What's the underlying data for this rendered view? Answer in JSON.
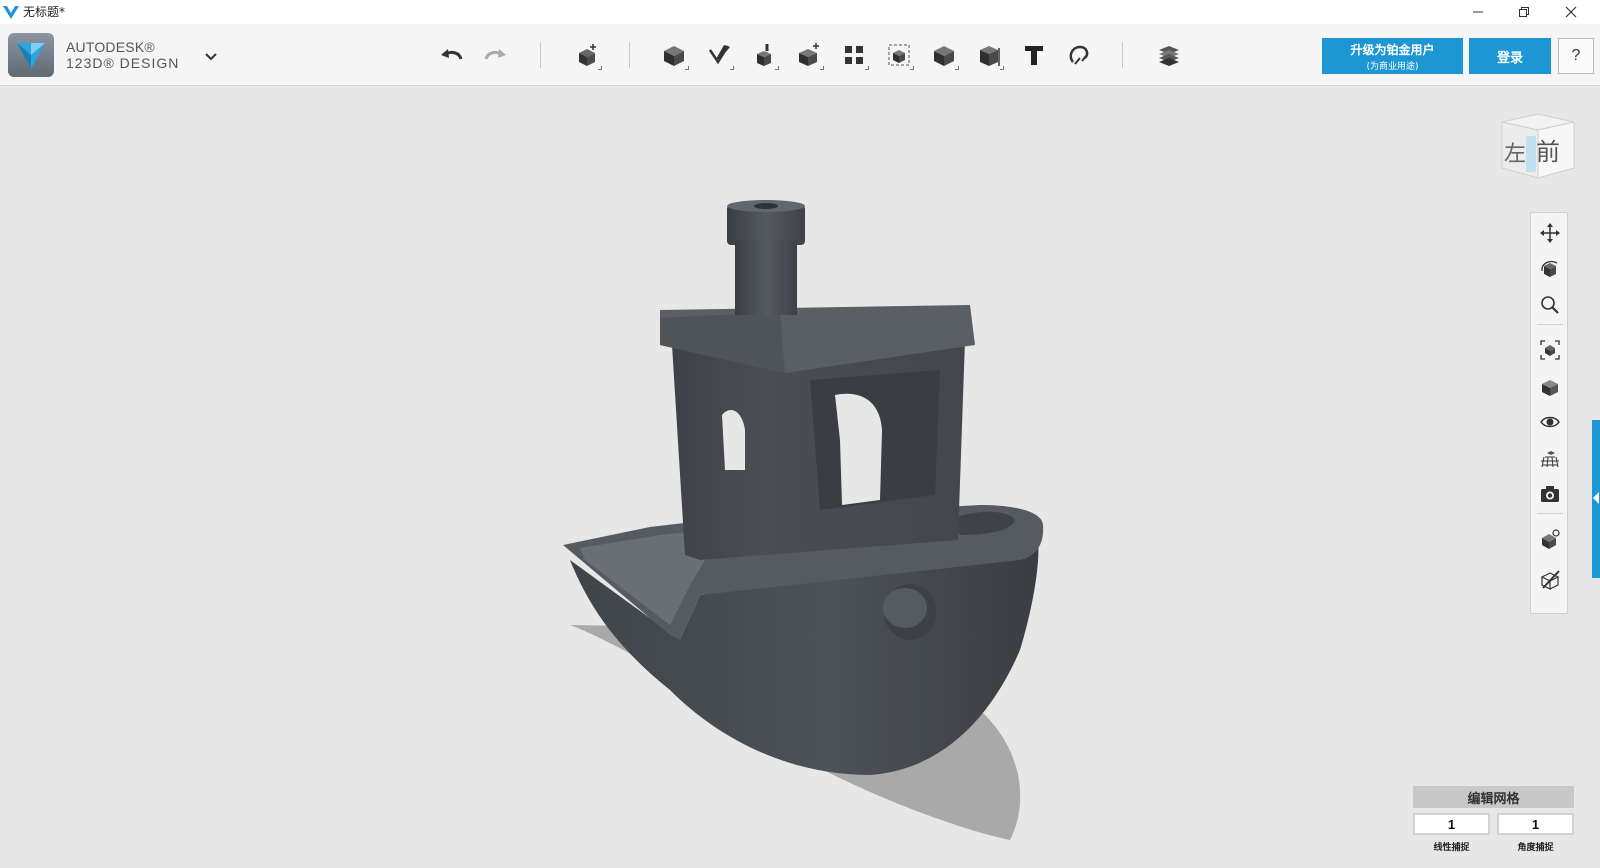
{
  "window": {
    "title": "无标题*",
    "controls": [
      "minimize",
      "restore",
      "close"
    ]
  },
  "brand": {
    "line1": "AUTODESK®",
    "line2": "123D® DESIGN"
  },
  "toolbar": {
    "tools": [
      {
        "name": "undo",
        "icon": "undo-arrow-icon"
      },
      {
        "name": "redo",
        "icon": "redo-arrow-icon"
      },
      {
        "name": "transform",
        "icon": "cube-move-icon"
      },
      {
        "name": "primitives",
        "icon": "primitive-box-icon"
      },
      {
        "name": "sketch",
        "icon": "sketch-pencil-icon"
      },
      {
        "name": "construct",
        "icon": "extrude-icon"
      },
      {
        "name": "modify",
        "icon": "modify-icon"
      },
      {
        "name": "pattern",
        "icon": "pattern-grid-icon"
      },
      {
        "name": "grouping",
        "icon": "group-icon"
      },
      {
        "name": "combine",
        "icon": "combine-icon"
      },
      {
        "name": "measure",
        "icon": "measure-icon"
      },
      {
        "name": "text",
        "icon": "text-icon"
      },
      {
        "name": "snap",
        "icon": "snap-magnet-icon"
      },
      {
        "name": "material",
        "icon": "material-stack-icon"
      }
    ],
    "upgrade_line1": "升级为铂金用户",
    "upgrade_line2": "(为商业用途)",
    "login_label": "登录",
    "help_label": "?"
  },
  "viewcube": {
    "left_face": "左",
    "front_face": "前"
  },
  "nav_panel": {
    "tools": [
      "pan-icon",
      "orbit-icon",
      "zoom-icon",
      "fit-icon",
      "views-icon",
      "visibility-icon",
      "grid-icon",
      "screenshot-icon",
      "material-icon",
      "outline-icon"
    ]
  },
  "snap_panel": {
    "title": "编辑网格",
    "linear_value": "1",
    "angle_value": "1",
    "linear_label": "线性捕捉",
    "angle_label": "角度捕捉"
  },
  "colors": {
    "accent": "#1c97d4",
    "model": "#4a4f55",
    "viewport": "#e7e7e7"
  }
}
